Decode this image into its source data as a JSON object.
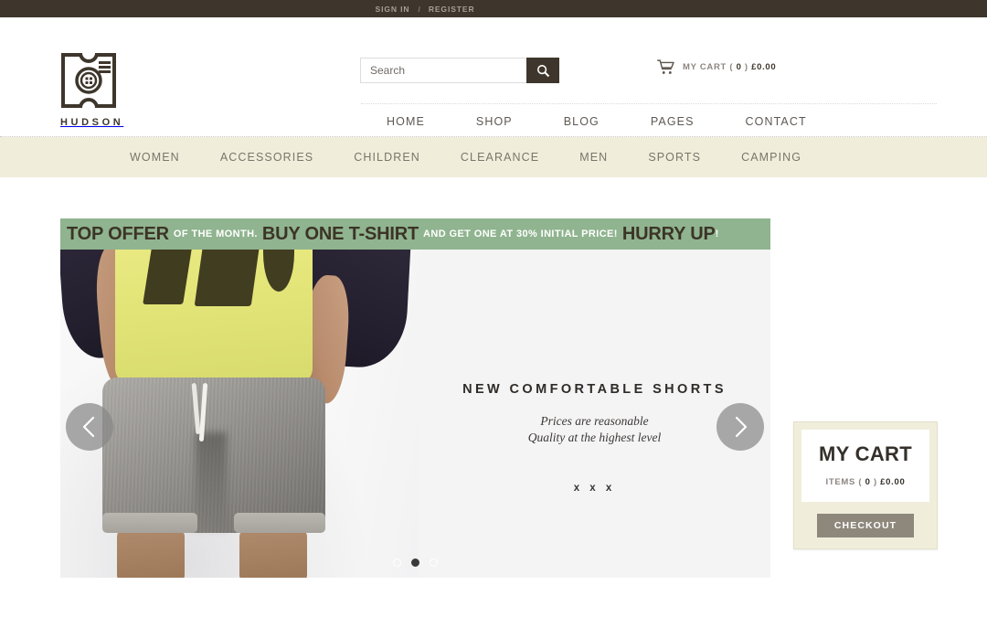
{
  "topbar": {
    "sign_in": "SIGN IN",
    "separator": "/",
    "register": "REGISTER"
  },
  "header": {
    "logo_text": "HUDSON",
    "logo_icon": "button-label-logo-icon",
    "search": {
      "placeholder": "Search",
      "value": "",
      "icon": "search-icon"
    },
    "cart": {
      "icon": "shopping-cart-icon",
      "label": "MY CART (",
      "count": "0",
      "mid": ")",
      "total": "£0.00"
    },
    "nav": [
      {
        "label": "HOME"
      },
      {
        "label": "SHOP"
      },
      {
        "label": "BLOG"
      },
      {
        "label": "PAGES"
      },
      {
        "label": "CONTACT"
      }
    ]
  },
  "categories": [
    {
      "label": "WOMEN"
    },
    {
      "label": "ACCESSORIES"
    },
    {
      "label": "CHILDREN"
    },
    {
      "label": "CLEARANCE"
    },
    {
      "label": "MEN"
    },
    {
      "label": "SPORTS"
    },
    {
      "label": "CAMPING"
    }
  ],
  "promo": {
    "part1": "TOP OFFER",
    "part2": "OF THE MONTH.",
    "part3": "BUY ONE T-SHIRT",
    "part4": "AND GET ONE AT 30% INITIAL PRICE!",
    "part5": "HURRY UP",
    "part6": "!"
  },
  "slide": {
    "title": "NEW COMFORTABLE SHORTS",
    "subtitle_line1": "Prices are reasonable",
    "subtitle_line2": "Quality at the highest level",
    "xxx": "x x x",
    "prev_icon": "chevron-left-icon",
    "next_icon": "chevron-right-icon",
    "dots": [
      {
        "active": false
      },
      {
        "active": true
      },
      {
        "active": false
      }
    ]
  },
  "cart_widget": {
    "title": "MY CART",
    "items_label": "ITEMS (",
    "items_count": "0",
    "items_mid": ")",
    "items_total": "£0.00",
    "checkout_label": "CHECKOUT"
  },
  "colors": {
    "topbar_bg": "#3e362c",
    "category_bg": "#f0eedb",
    "promo_green": "#8fb48f",
    "promo_text_dark": "#3c3427",
    "checkout_btn": "#8e887c",
    "brand_dark": "#35302a"
  }
}
